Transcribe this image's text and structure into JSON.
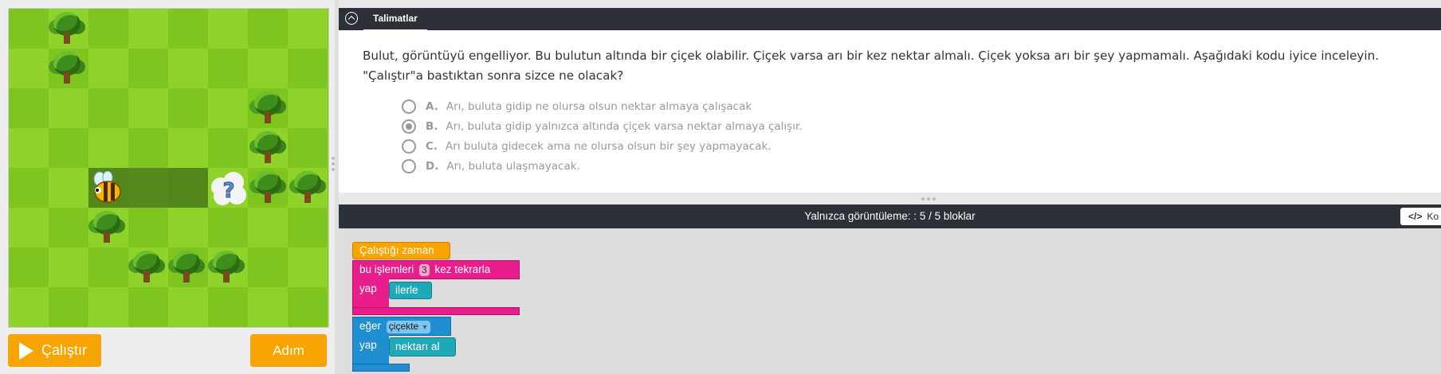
{
  "run_button": {
    "label": "Çalıştır"
  },
  "step_button": {
    "label": "Adım"
  },
  "instructions": {
    "tab_label": "Talimatlar",
    "question": "Bulut, görüntüyü engelliyor. Bu bulutun altında bir çiçek olabilir. Çiçek varsa arı bir kez nektar almalı. Çiçek yoksa arı bir şey yapmamalı. Aşağıdaki kodu iyice inceleyin. \"Çalıştır\"a bastıktan sonra sizce ne olacak?",
    "options": [
      {
        "letter": "A.",
        "text": "Arı, buluta gidip ne olursa olsun nektar almaya çalışacak",
        "selected": false
      },
      {
        "letter": "B.",
        "text": "Arı, buluta gidip yalnızca altında çiçek varsa nektar almaya çalışır.",
        "selected": true
      },
      {
        "letter": "C.",
        "text": "Arı buluta gidecek ama ne olursa olsun bir şey yapmayacak.",
        "selected": false
      },
      {
        "letter": "D.",
        "text": "Arı, buluta ulaşmayacak.",
        "selected": false
      }
    ]
  },
  "workspace": {
    "header": "Yalnızca görüntüleme: : 5 / 5 bloklar",
    "code_button": "Ko",
    "blocks": {
      "when_run": "Çalıştığı zaman",
      "repeat_prefix": "bu işlemleri",
      "repeat_count": "3",
      "repeat_suffix": "kez tekrarla",
      "do_label_1": "yap",
      "move": "ilerle",
      "if_label": "eğer",
      "condition": "çiçekte",
      "do_label_2": "yap",
      "action": "nektarı al"
    }
  },
  "colors": {
    "accent_orange": "#f7a400",
    "header_dark": "#2c3137",
    "block_event": "#f7a400",
    "block_loop": "#e91e8c",
    "block_if": "#1f8fd1",
    "block_action": "#1fa8b8"
  }
}
